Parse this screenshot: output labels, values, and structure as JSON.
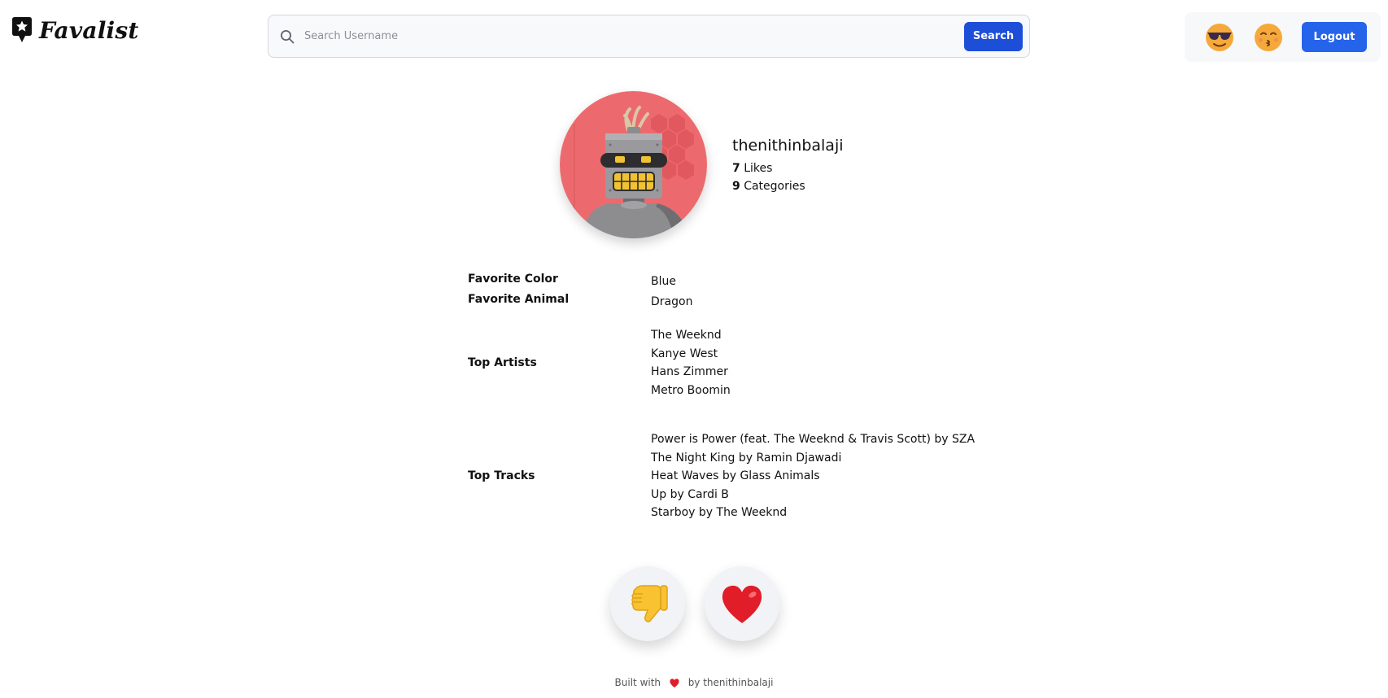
{
  "app": {
    "name": "Favalist",
    "logo_icon": "star-badge-icon"
  },
  "search": {
    "placeholder": "Search Username",
    "button_label": "Search"
  },
  "user_panel": {
    "emoji_1": "sunglasses-emoji-icon",
    "emoji_2": "kissing-emoji-icon",
    "logout_label": "Logout"
  },
  "profile": {
    "username": "thenithinbalaji",
    "likes_count": "7",
    "likes_label": "Likes",
    "categories_count": "9",
    "categories_label": "Categories",
    "avatar_icon": "robot-avatar-icon"
  },
  "details": {
    "color": {
      "label": "Favorite Color",
      "value": "Blue"
    },
    "animal": {
      "label": "Favorite Animal",
      "value": "Dragon"
    },
    "artists": {
      "label": "Top Artists",
      "items": [
        "The Weeknd",
        "Kanye West",
        "Hans Zimmer",
        "Metro Boomin"
      ]
    },
    "tracks": {
      "label": "Top Tracks",
      "items": [
        "Power is Power (feat. The Weeknd & Travis Scott) by SZA",
        "The Night King by Ramin Djawadi",
        "Heat Waves by Glass Animals",
        "Up by Cardi B",
        "Starboy by The Weeknd"
      ]
    }
  },
  "reactions": {
    "dislike_icon": "thumbs-down-icon",
    "like_icon": "heart-icon"
  },
  "footer": {
    "prefix": "Built with",
    "suffix": "by thenithinbalaji"
  },
  "colors": {
    "primary": "#1d4ed8",
    "avatar_bg": "#ec6a6e",
    "heart": "#e11d2a"
  }
}
